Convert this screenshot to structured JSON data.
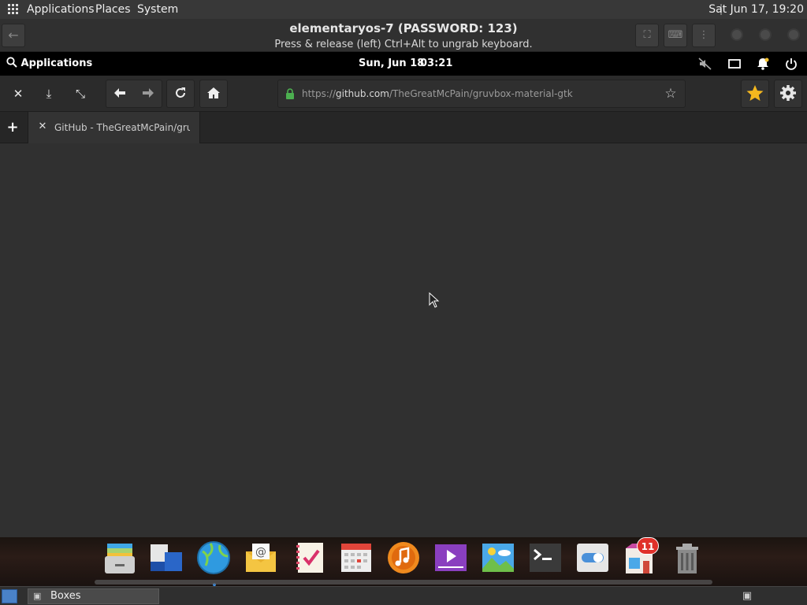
{
  "host_panel": {
    "menu_applications": "Applications",
    "menu_places": "Places",
    "menu_system": "System",
    "clock": "Sat Jun 17, 19:20"
  },
  "boxes": {
    "title": "elementaryos-7 (PASSWORD: 123)",
    "hint": "Press & release (left) Ctrl+Alt to ungrab keyboard."
  },
  "guest_panel": {
    "applications_label": "Applications",
    "date": "Sun, Jun 18",
    "time": "03:21"
  },
  "browser": {
    "url_prefix": "https://",
    "url_domain": "github.com",
    "url_path": "/TheGreatMcPain/gruvbox-material-gtk",
    "tab_title": "GitHub - TheGreatMcPain/gruvbox-material-gtk"
  },
  "dock": {
    "notification_badge": "11",
    "items": [
      {
        "icon": "files-icon",
        "color": "#d9d9d9"
      },
      {
        "icon": "multitasking-view-icon",
        "color": "#2a66c8"
      },
      {
        "icon": "web-browser-icon",
        "color": "#3aa0e0"
      },
      {
        "icon": "mail-icon",
        "color": "#f2c744"
      },
      {
        "icon": "tasks-icon",
        "color": "#f6f0e6"
      },
      {
        "icon": "calendar-icon",
        "color": "#e8e8e8"
      },
      {
        "icon": "music-icon",
        "color": "#f08a1e"
      },
      {
        "icon": "videos-icon",
        "color": "#8a3fbf"
      },
      {
        "icon": "photos-icon",
        "color": "#4aa8e8"
      },
      {
        "icon": "terminal-icon",
        "color": "#333333"
      },
      {
        "icon": "system-settings-icon",
        "color": "#e6e6e6"
      },
      {
        "icon": "appcenter-icon",
        "color": "#c94aa2"
      },
      {
        "icon": "trash-icon",
        "color": "#8a8a8a"
      }
    ]
  },
  "host_taskbar": {
    "task_label": "Boxes"
  }
}
